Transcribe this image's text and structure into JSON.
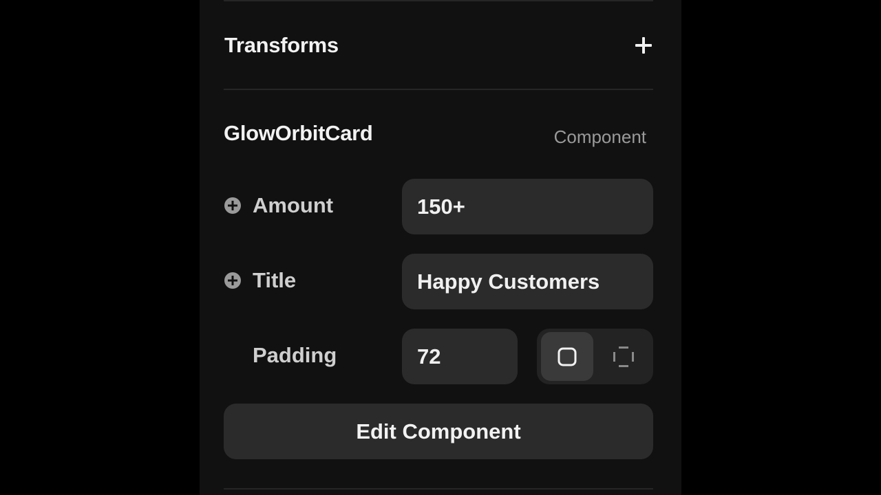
{
  "transforms": {
    "title": "Transforms",
    "add_icon": "plus-icon"
  },
  "component": {
    "name": "GlowOrbitCard",
    "type_label": "Component"
  },
  "properties": [
    {
      "label": "Amount",
      "value": "150+",
      "icon": "plus-circle-icon"
    },
    {
      "label": "Title",
      "value": "Happy Customers",
      "icon": "plus-circle-icon"
    }
  ],
  "padding": {
    "label": "Padding",
    "value": "72",
    "modes": [
      {
        "icon": "padding-uniform-icon",
        "active": true
      },
      {
        "icon": "padding-individual-icon",
        "active": false
      }
    ]
  },
  "edit_button": {
    "label": "Edit Component"
  },
  "colors": {
    "panel_bg": "#111111",
    "field_bg": "#2b2b2b",
    "text_primary": "#f2f2f2",
    "text_secondary": "#9a9a9a"
  }
}
